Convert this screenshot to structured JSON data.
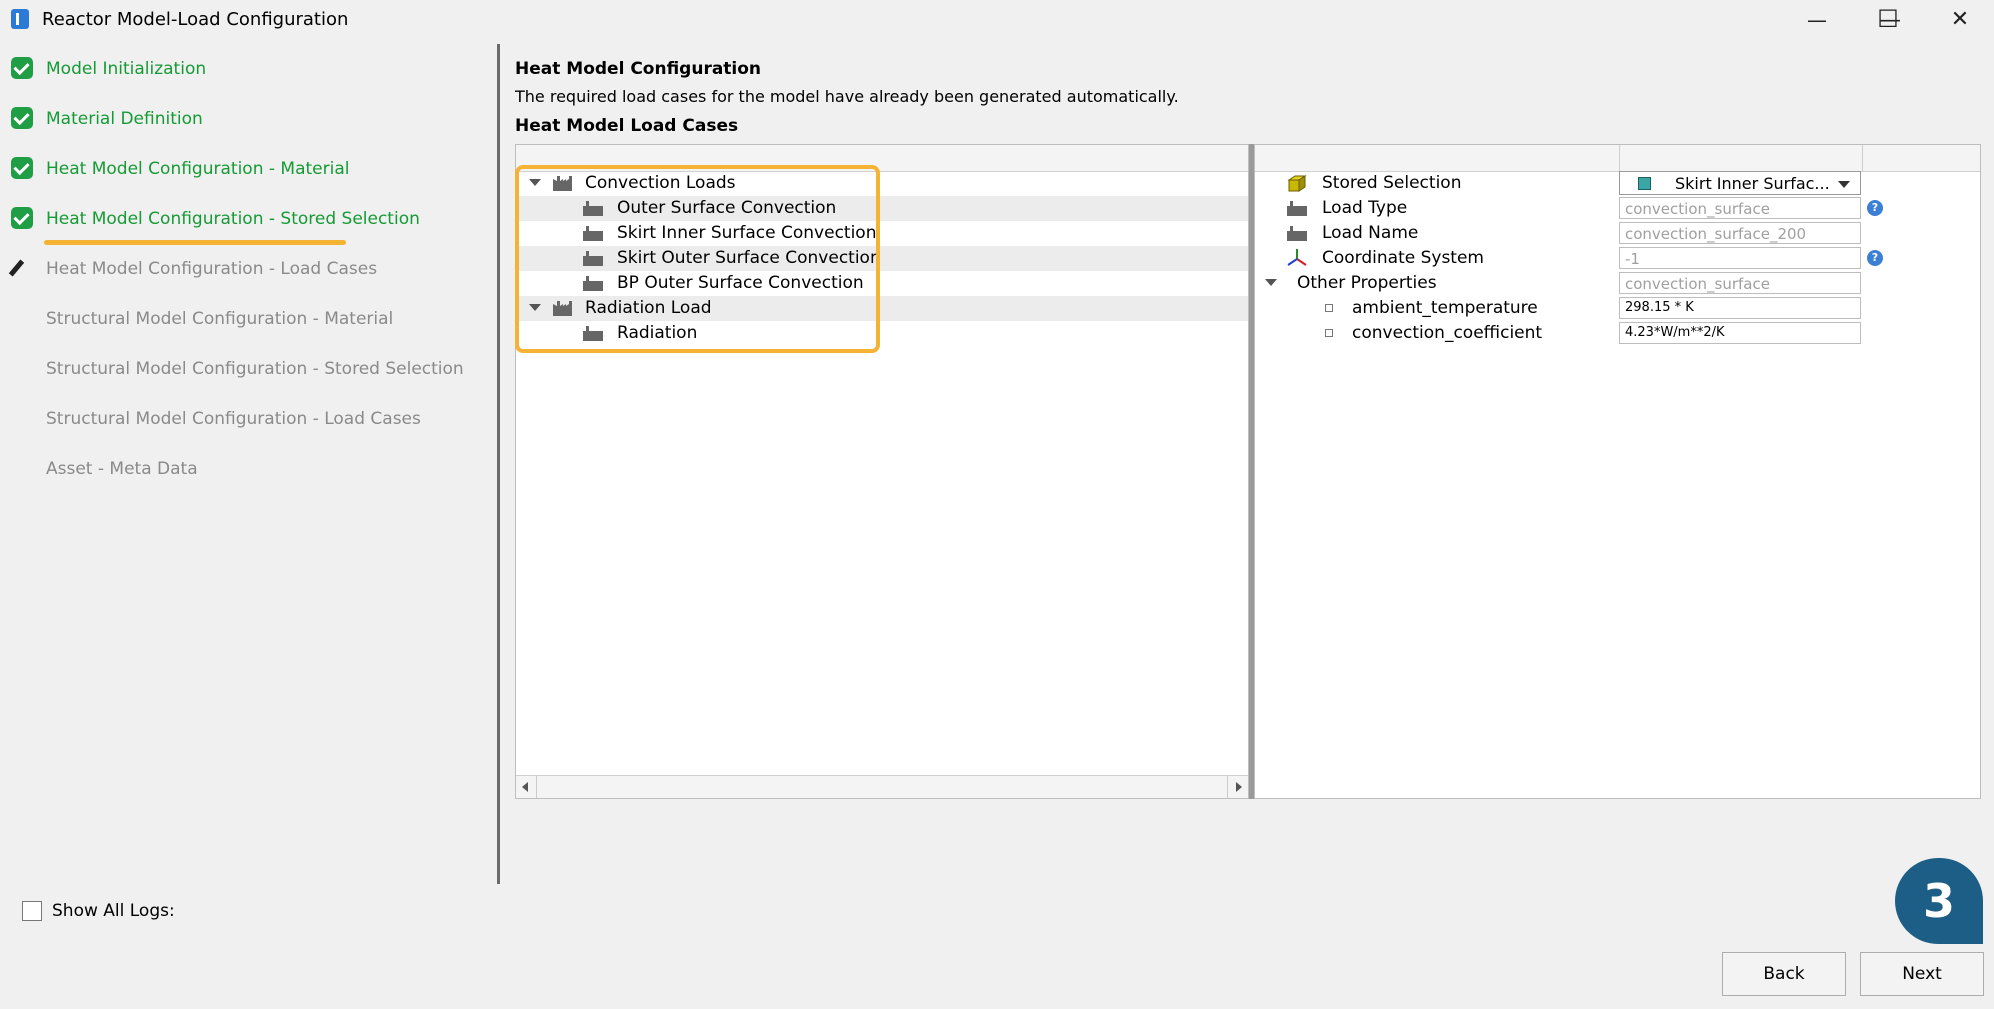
{
  "window": {
    "title": "Reactor Model-Load Configuration",
    "minimize": "—",
    "maximize": "☐",
    "close": "✕"
  },
  "steps": [
    {
      "label": "Model Initialization",
      "state": "done"
    },
    {
      "label": "Material Definition",
      "state": "done"
    },
    {
      "label": "Heat Model Configuration - Material",
      "state": "done"
    },
    {
      "label": "Heat Model Configuration - Stored Selection",
      "state": "done"
    },
    {
      "label": "Heat Model Configuration - Load Cases",
      "state": "current"
    },
    {
      "label": "Structural Model Configuration - Material",
      "state": "todo"
    },
    {
      "label": "Structural Model Configuration - Stored Selection",
      "state": "todo"
    },
    {
      "label": "Structural Model Configuration - Load Cases",
      "state": "todo"
    },
    {
      "label": "Asset - Meta Data",
      "state": "todo"
    }
  ],
  "main": {
    "heading": "Heat Model Configuration",
    "description": "The required load cases for the model have already been generated automatically.",
    "subheading": "Heat Model Load Cases"
  },
  "tree": {
    "groups": [
      {
        "label": "Convection Loads",
        "children": [
          "Outer Surface Convection",
          "Skirt Inner Surface Convection",
          "Skirt Outer Surface Convection",
          "BP Outer Surface Convection"
        ]
      },
      {
        "label": "Radiation Load",
        "children": [
          "Radiation"
        ]
      }
    ]
  },
  "properties": {
    "stored_selection": {
      "label": "Stored Selection",
      "value": "Skirt Inner Surfac..."
    },
    "load_type": {
      "label": "Load Type",
      "value": "convection_surface"
    },
    "load_name": {
      "label": "Load Name",
      "value": "convection_surface_200"
    },
    "coordinate_system": {
      "label": "Coordinate System",
      "value": "-1"
    },
    "other_properties": {
      "label": "Other Properties",
      "value": "convection_surface"
    },
    "ambient_temperature": {
      "label": "ambient_temperature",
      "value": "298.15 * K"
    },
    "convection_coefficient": {
      "label": "convection_coefficient",
      "value": "4.23*W/m**2/K"
    },
    "help_glyph": "?"
  },
  "footer": {
    "show_all_logs": "Show All Logs:",
    "back": "Back",
    "next": "Next",
    "badge": "3"
  },
  "colors": {
    "done_green": "#169a35",
    "highlight": "#f5b335",
    "badge": "#1d5e86"
  }
}
